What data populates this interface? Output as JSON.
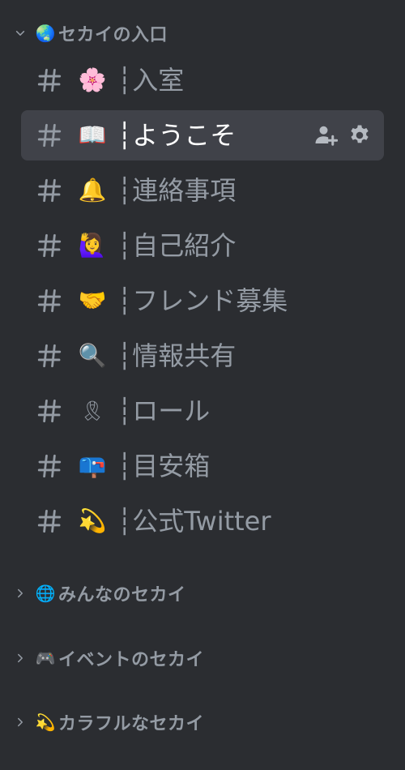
{
  "colors": {
    "background": "#2b2d31",
    "selected_background": "#404249",
    "muted_text": "#949ba4",
    "active_text": "#ffffff"
  },
  "categories": [
    {
      "label": "セカイの入口",
      "emoji": "🌏",
      "expanded": true
    },
    {
      "label": "みんなのセカイ",
      "emoji": "🌐",
      "expanded": false
    },
    {
      "label": "イベントのセカイ",
      "emoji": "🎮",
      "expanded": false
    },
    {
      "label": "カラフルなセカイ",
      "emoji": "💫",
      "expanded": false
    }
  ],
  "channels": [
    {
      "label": "入室",
      "emoji": "🌸",
      "selected": false
    },
    {
      "label": "ようこそ",
      "emoji": "📖",
      "selected": true
    },
    {
      "label": "連絡事項",
      "emoji": "🔔",
      "selected": false
    },
    {
      "label": "自己紹介",
      "emoji": "🙋‍♀️",
      "selected": false
    },
    {
      "label": "フレンド募集",
      "emoji": "🤝",
      "selected": false
    },
    {
      "label": "情報共有",
      "emoji": "🔍",
      "selected": false
    },
    {
      "label": "ロール",
      "emoji": "🎗",
      "selected": false
    },
    {
      "label": "目安箱",
      "emoji": "📪",
      "selected": false
    },
    {
      "label": "公式Twitter",
      "emoji": "💫",
      "selected": false
    }
  ],
  "channel_separator": "┆",
  "channel_actions": {
    "invite_icon": "add-member-icon",
    "settings_icon": "gear-icon"
  }
}
